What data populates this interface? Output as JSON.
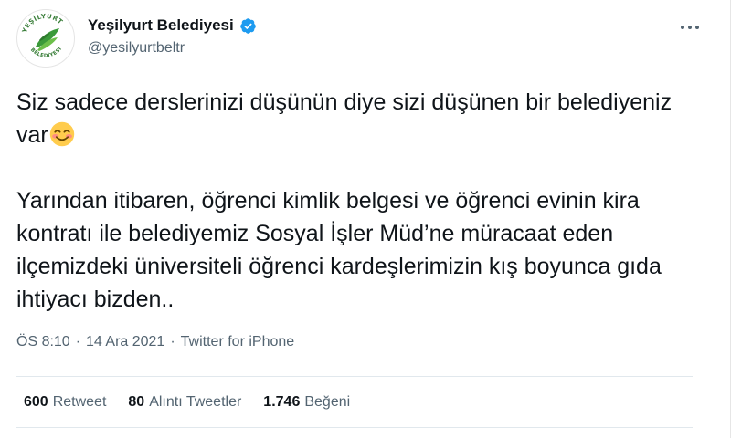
{
  "account": {
    "display_name": "Yeşilyurt Belediyesi",
    "handle": "@yesilyurtbeltr",
    "avatar_logo_text": "YEŞİLYURT BELEDİYESİ"
  },
  "tweet": {
    "paragraph1": "Siz sadece derslerinizi düşünün diye sizi düşünen bir belediyeniz var",
    "paragraph1_emoji": "smiling-face-with-smiling-eyes",
    "paragraph2": "Yarından itibaren, öğrenci kimlik belgesi ve öğrenci evinin kira kontratı ile belediyemiz Sosyal İşler Müd’ne müracaat eden ilçemizdeki üniversiteli öğrenci kardeşlerimizin kış boyunca gıda ihtiyacı bizden.."
  },
  "meta": {
    "time": "ÖS 8:10",
    "separator": "·",
    "date": "14 Ara 2021",
    "source": "Twitter for iPhone"
  },
  "stats": {
    "retweets_count": "600",
    "retweets_label": "Retweet",
    "quotes_count": "80",
    "quotes_label": "Alıntı Tweetler",
    "likes_count": "1.746",
    "likes_label": "Beğeni"
  },
  "icons": {
    "more": "more-horizontal-icon",
    "verified": "verified-badge-icon"
  },
  "colors": {
    "verified_blue": "#1d9bf0",
    "secondary_text": "#536471",
    "primary_text": "#0f1419",
    "logo_green": "#3a9a3a"
  }
}
